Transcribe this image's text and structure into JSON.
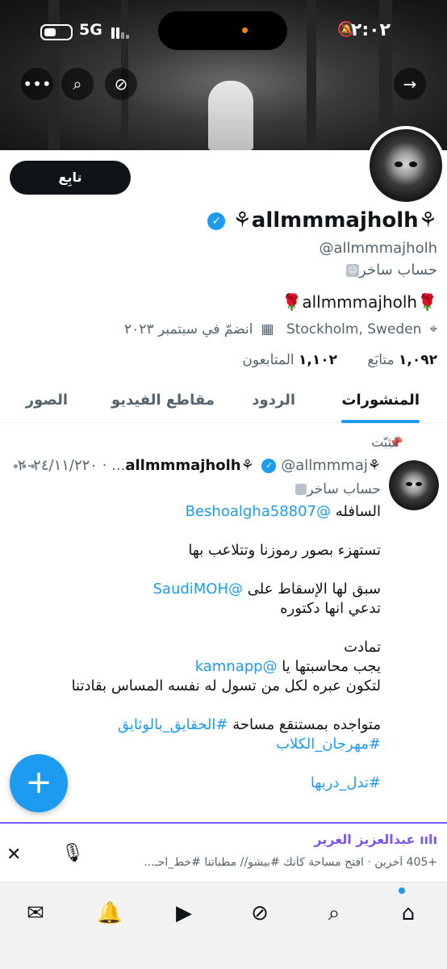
{
  "status_bar": {
    "time": "٢:٠٢",
    "network": "5G"
  },
  "header_actions": {
    "back_glyph": "→",
    "grok_glyph": "⊘",
    "search_glyph": "⌕",
    "more_glyph": "•••"
  },
  "profile": {
    "follow_label": "تابِع",
    "display_name": "⚘allmmmajholh⚘",
    "handle": "@allmmmajholh",
    "label": "حساب ساخر",
    "bio": "🌹allmmmajholh🌹",
    "location": "Stockholm, Sweden",
    "joined": "انضمّ في سبتمبر ٢٠٢٣",
    "following_count": "١,٠٩٢",
    "following_label": "متابَع",
    "followers_count": "١,١٠٢",
    "followers_label": "المتابعون"
  },
  "tabs": [
    {
      "label": "المنشورات",
      "active": true
    },
    {
      "label": "الردود",
      "active": false
    },
    {
      "label": "مقاطع الفيديو",
      "active": false
    },
    {
      "label": "الصور",
      "active": false
    }
  ],
  "post": {
    "pinned_label": "مُثبّت",
    "author_name": "⚘allmmmajholh⚘",
    "author_handle": "@allmmmaj...",
    "date": "٢٠٢٤/١١/٢٢٠",
    "label": "حساب ساخر",
    "line1_prefix": "السافله",
    "line1_mention": "@Beshoalgha58807",
    "line2": "تستهزء بصور رموزنا وتتلاعب بها",
    "line3_prefix": "سبق لها الإسقاط على",
    "line3_mention": "@SaudiMOH",
    "line4": "تدعي انها دكتوره",
    "line5": "تمادت",
    "line6_prefix": "يجب محاسبتها يا",
    "line6_mention": "@kamnapp",
    "line7": "لتكون عبره لكل من تسول له نفسه المساس بقادتنا",
    "line8_prefix": "متواجده بمستنقع مساحة",
    "line8_hashtag": "#الحقايق_بالوثايق",
    "line9_hashtag": "#مهرجان_الكلاب",
    "line10_hashtag": "#تدل_دربها"
  },
  "fab_label": "+",
  "space": {
    "host": "عبدالعزيز الغرير",
    "subtitle": "+405 آخرين · افتح مساحة كأنك #بيشو// مطباتنا #خط_احـ..."
  },
  "colors": {
    "accent": "#1d9bf0",
    "space_accent": "#7856ff",
    "text": "#0f1419",
    "muted": "#536471"
  }
}
